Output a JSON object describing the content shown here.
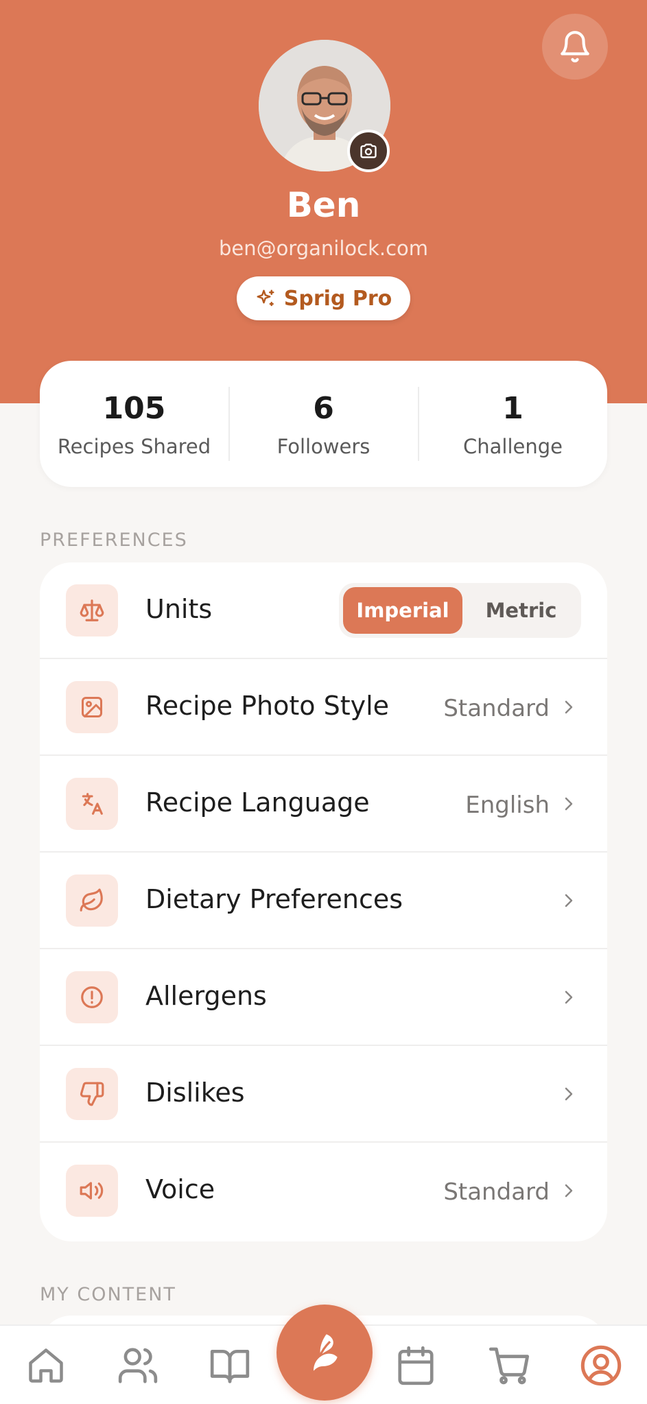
{
  "theme": {
    "accent": "#dc7856",
    "accent_light": "#fbe8e1",
    "pro_text": "#b35a1f"
  },
  "profile": {
    "name": "Ben",
    "email": "ben@organilock.com",
    "badge": "Sprig Pro"
  },
  "stats": [
    {
      "value": "105",
      "label": "Recipes Shared"
    },
    {
      "value": "6",
      "label": "Followers"
    },
    {
      "value": "1",
      "label": "Challenge"
    }
  ],
  "preferences": {
    "section_title": "PREFERENCES",
    "units": {
      "label": "Units",
      "options": [
        "Imperial",
        "Metric"
      ],
      "selected": "Imperial"
    },
    "rows": [
      {
        "label": "Recipe Photo Style",
        "value": "Standard",
        "icon": "image-icon"
      },
      {
        "label": "Recipe Language",
        "value": "English",
        "icon": "translate-icon"
      },
      {
        "label": "Dietary Preferences",
        "value": "",
        "icon": "leaf-icon"
      },
      {
        "label": "Allergens",
        "value": "",
        "icon": "alert-circle-icon"
      },
      {
        "label": "Dislikes",
        "value": "",
        "icon": "thumbs-down-icon"
      },
      {
        "label": "Voice",
        "value": "Standard",
        "icon": "speaker-icon"
      }
    ]
  },
  "my_content": {
    "section_title": "MY CONTENT"
  },
  "tabbar": {
    "items": [
      "home-icon",
      "users-icon",
      "book-icon",
      "sprig-icon",
      "calendar-icon",
      "cart-icon",
      "profile-icon"
    ],
    "active": "profile-icon"
  }
}
